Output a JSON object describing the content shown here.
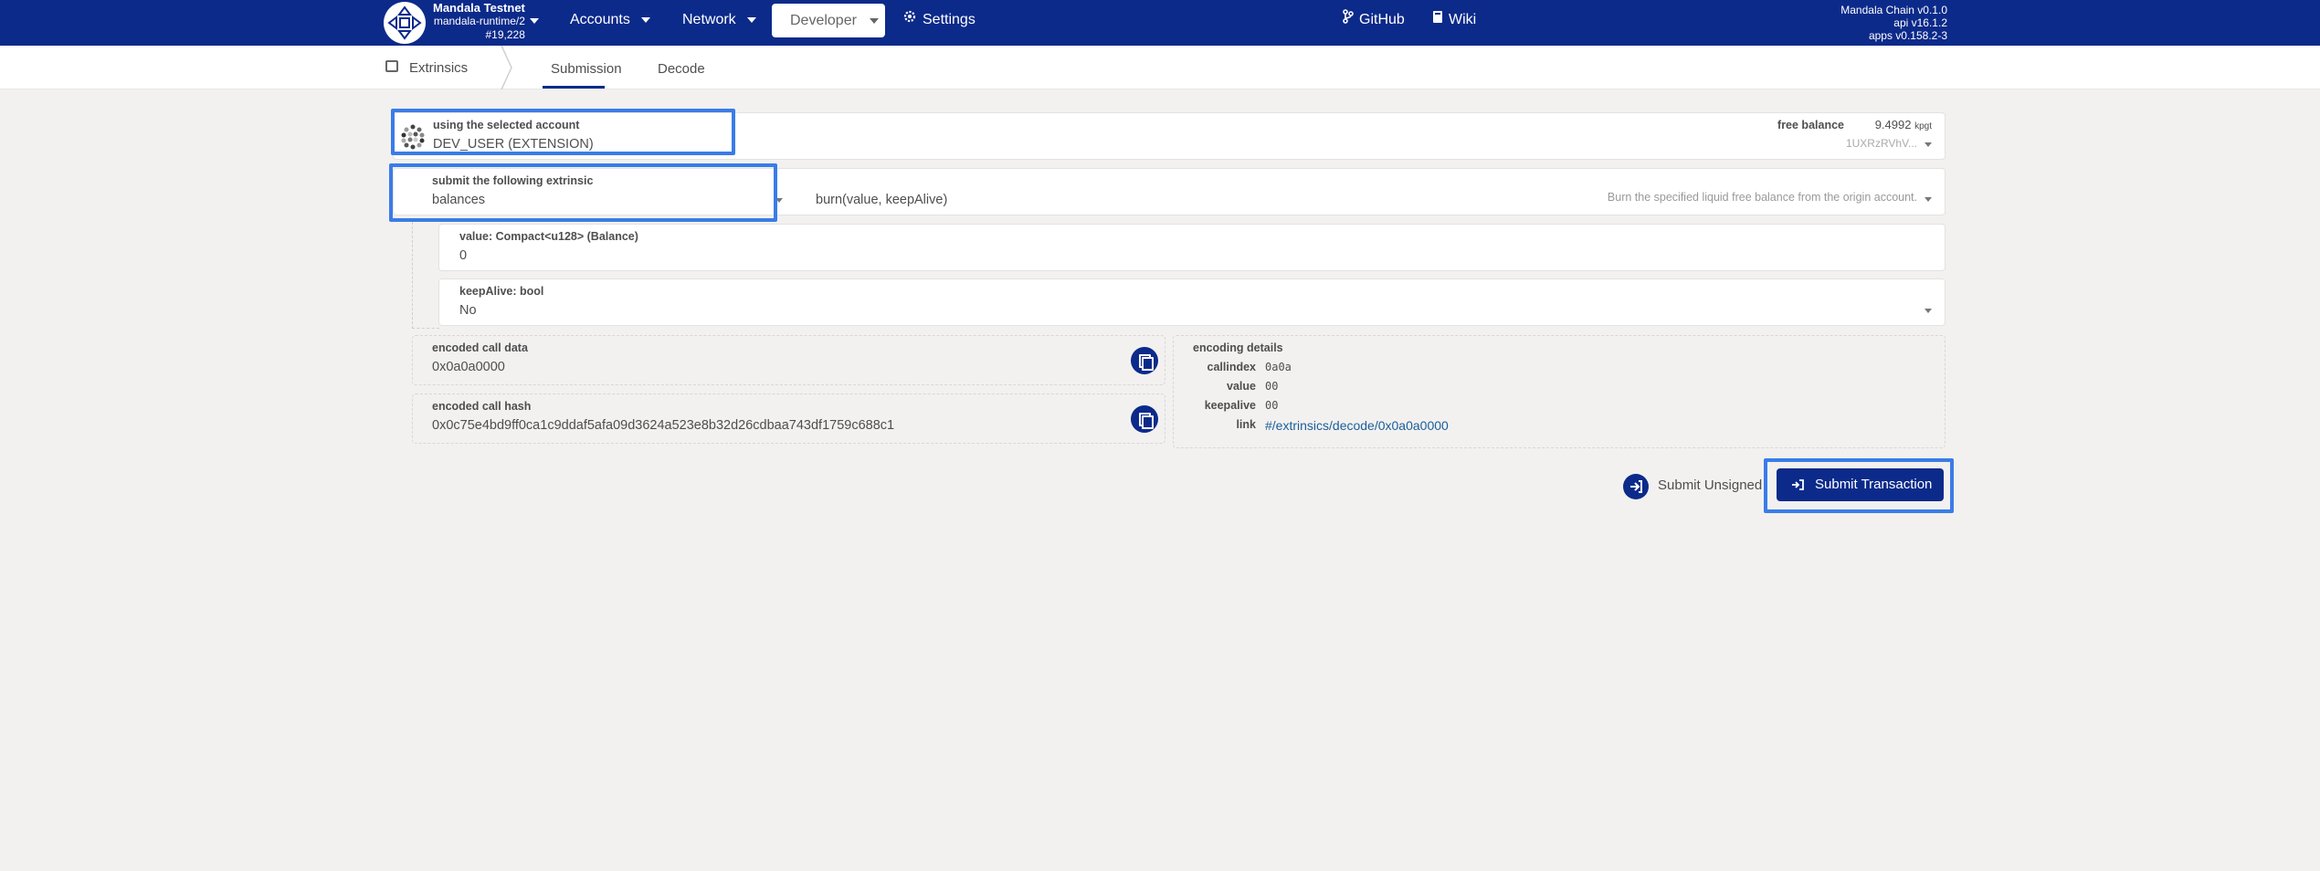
{
  "header": {
    "chain_name": "Mandala Testnet",
    "runtime": "mandala-runtime/2",
    "block": "#19,228",
    "nav": {
      "accounts": "Accounts",
      "network": "Network",
      "developer": "Developer",
      "settings": "Settings",
      "github": "GitHub",
      "wiki": "Wiki"
    },
    "versions": {
      "chain": "Mandala Chain v0.1.0",
      "api": "api v16.1.2",
      "apps": "apps v0.158.2-3"
    }
  },
  "subnav": {
    "section": "Extrinsics",
    "tabs": [
      "Submission",
      "Decode"
    ],
    "active_tab": "Submission"
  },
  "account": {
    "label": "using the selected account",
    "value": "DEV_USER (EXTENSION)",
    "free_balance_label": "free balance",
    "free_balance_value": "9.4992",
    "free_balance_unit": "kpgt",
    "address": "1UXRzRVhV..."
  },
  "extrinsic": {
    "label": "submit the following extrinsic",
    "module": "balances",
    "method": "burn(value, keepAlive)",
    "description": "Burn the specified liquid free balance from the origin account."
  },
  "params": [
    {
      "label": "value: Compact<u128> (Balance)",
      "value": "0"
    },
    {
      "label": "keepAlive: bool",
      "value": "No"
    }
  ],
  "encoded_call_data": {
    "label": "encoded call data",
    "value": "0x0a0a0000"
  },
  "encoded_call_hash": {
    "label": "encoded call hash",
    "value": "0x0c75e4bd9ff0ca1c9ddaf5afa09d3624a523e8b32d26cdbaa743df1759c688c1"
  },
  "encoding_details": {
    "title": "encoding details",
    "rows": [
      {
        "key": "callindex",
        "value": "0a0a"
      },
      {
        "key": "value",
        "value": "00"
      },
      {
        "key": "keepalive",
        "value": "00"
      },
      {
        "key": "link",
        "value": "#/extrinsics/decode/0x0a0a0000"
      }
    ]
  },
  "actions": {
    "submit_unsigned": "Submit Unsigned",
    "submit_transaction": "Submit Transaction"
  },
  "colors": {
    "brand": "#0c2a8a",
    "highlight": "#3a7ce8",
    "background": "#f2f1f0",
    "link": "#1a5e9a"
  }
}
